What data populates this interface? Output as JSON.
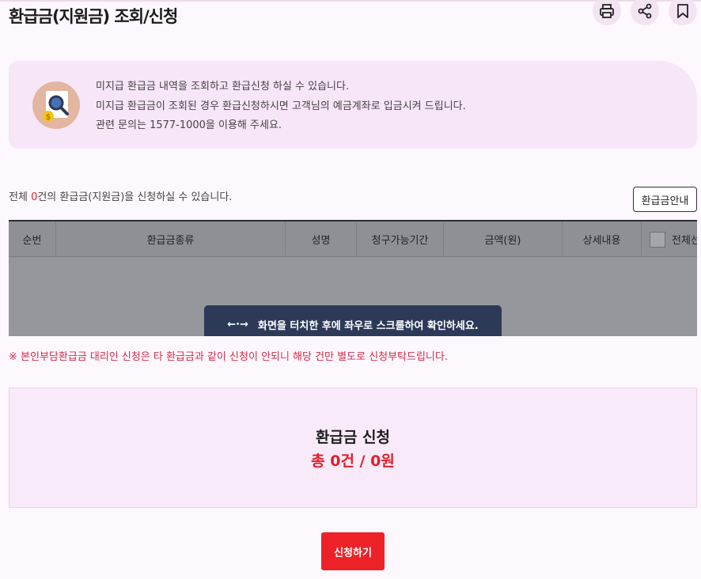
{
  "header": {
    "title": "환급금(지원금) 조회/신청",
    "buttons": [
      {
        "icon": "print-icon"
      },
      {
        "icon": "share-icon"
      },
      {
        "icon": "bookmark-icon"
      }
    ]
  },
  "info": {
    "icon": "document-search-icon",
    "lines": [
      "미지급 환급금 내역을 조회하고 환급신청 하실 수 있습니다.",
      "미지급 환급금이 조회된 경우 환급신청하시면 고객님의 예금계좌로 입금시켜 드립니다.",
      "관련 문의는 1577-1000을 이용해 주세요."
    ]
  },
  "summary": {
    "prefix": "전체 ",
    "count": "0",
    "suffix": "건의 환급금(지원금)을 신청하실 수 있습니다."
  },
  "guide_button": "환급금안내",
  "table": {
    "columns": [
      "순번",
      "환급금종류",
      "성명",
      "청구가능기간",
      "금액(원)",
      "상세내용",
      "전체선택"
    ],
    "scroll_hint": "화면을 터치한 후에 좌우로 스크롤하여 확인하세요.",
    "scroll_hint_icon": "←·→"
  },
  "notice": "※ 본인부담환급금 대리인 신청은 타 환급금과 같이 신청이 안되니 해당 건만 별도로 신청부탁드립니다.",
  "total": {
    "label": "환급금 신청",
    "value": "총 0건 / 0원"
  },
  "apply_button": "신청하기",
  "colors": {
    "accent": "#ed2228",
    "toast_bg": "#2c3a58",
    "info_bg": "#f7e6f7"
  }
}
